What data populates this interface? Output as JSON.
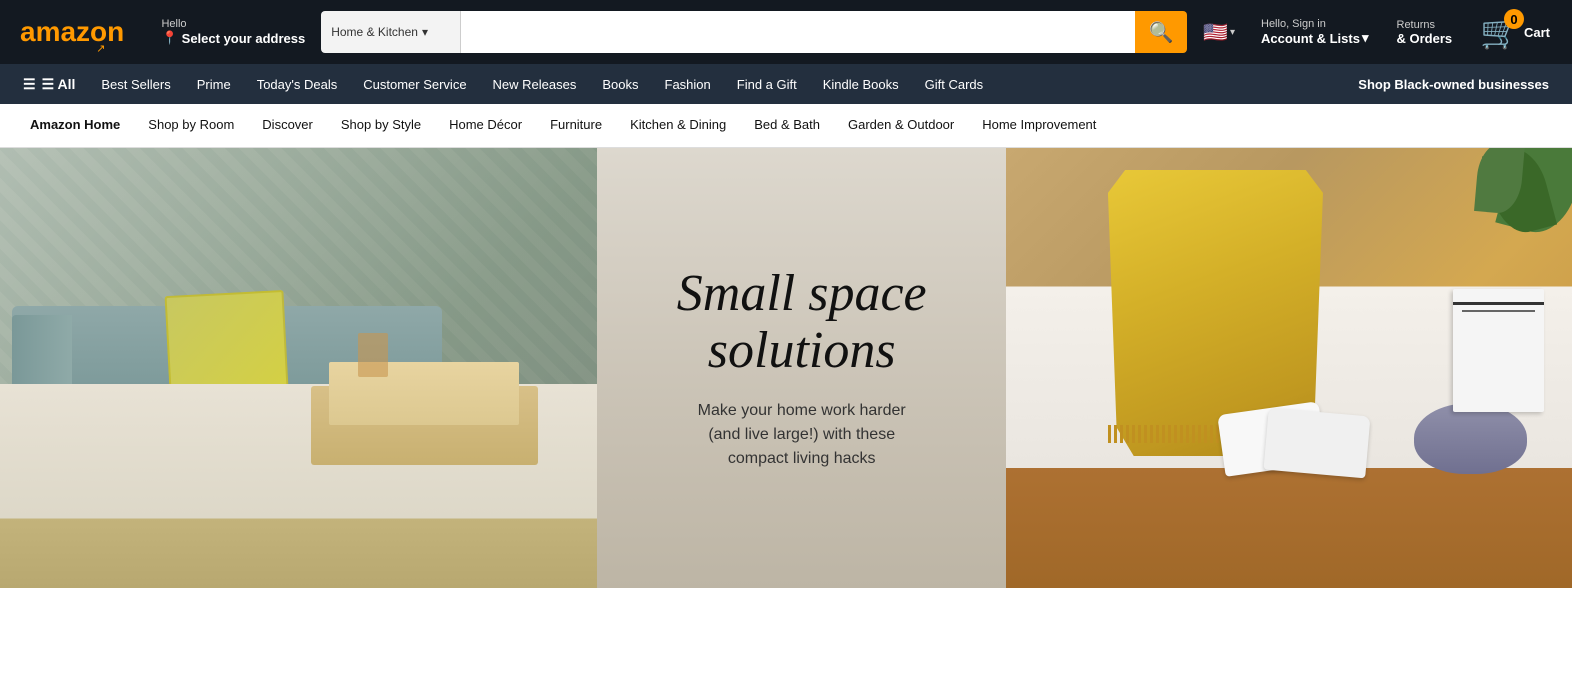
{
  "logo": {
    "text": "amazon",
    "smile": "↗"
  },
  "address": {
    "hello": "Hello",
    "select_label": "Select your address"
  },
  "search": {
    "category": "Home & Kitchen",
    "placeholder": ""
  },
  "flag": {
    "emoji": "🇺🇸",
    "chevron": "▾"
  },
  "account": {
    "hello": "Hello, Sign in",
    "label": "Account & Lists",
    "chevron": "▾"
  },
  "returns": {
    "line1": "Returns",
    "line2": "& Orders"
  },
  "cart": {
    "count": "0",
    "label": "Cart"
  },
  "secondary_nav": {
    "all": "☰ All",
    "items": [
      "Best Sellers",
      "Prime",
      "Today's Deals",
      "Customer Service",
      "New Releases",
      "Books",
      "Fashion",
      "Find a Gift",
      "Kindle Books",
      "Gift Cards"
    ],
    "promo": "Shop Black-owned businesses"
  },
  "category_nav": {
    "items": [
      "Amazon Home",
      "Shop by Room",
      "Discover",
      "Shop by Style",
      "Home Décor",
      "Furniture",
      "Kitchen & Dining",
      "Bed & Bath",
      "Garden & Outdoor",
      "Home Improvement"
    ]
  },
  "hero": {
    "title": "Small space solutions",
    "subtitle_line1": "Make your home work harder",
    "subtitle_line2": "(and live large!) with these",
    "subtitle_line3": "compact living hacks"
  }
}
